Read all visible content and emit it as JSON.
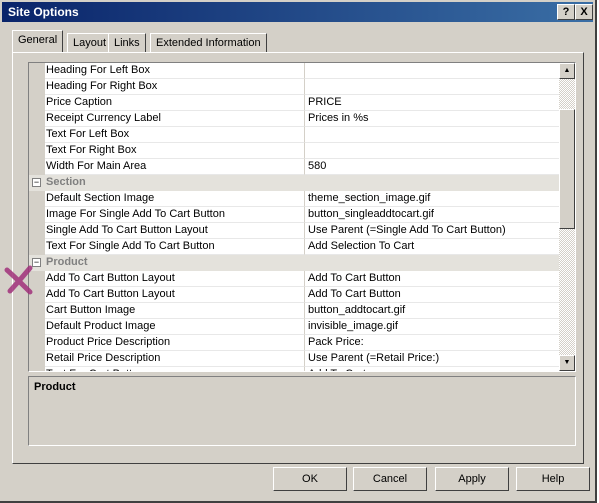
{
  "window": {
    "title": "Site Options",
    "help": "?",
    "close": "X"
  },
  "tabs": [
    "General",
    "Layout",
    "Links",
    "Extended Information"
  ],
  "left_fragment": "es",
  "rows": [
    {
      "type": "prop",
      "label": "Heading For Left Box",
      "value": ""
    },
    {
      "type": "prop",
      "label": "Heading For Right Box",
      "value": ""
    },
    {
      "type": "prop",
      "label": "Price Caption",
      "value": "PRICE"
    },
    {
      "type": "prop",
      "label": "Receipt Currency Label",
      "value": "Prices in %s"
    },
    {
      "type": "prop",
      "label": "Text For Left Box",
      "value": ""
    },
    {
      "type": "prop",
      "label": "Text For Right Box",
      "value": ""
    },
    {
      "type": "prop",
      "label": "Width For Main Area",
      "value": "580"
    },
    {
      "type": "cat",
      "label": "Section"
    },
    {
      "type": "prop",
      "label": "Default Section Image",
      "value": "theme_section_image.gif"
    },
    {
      "type": "prop",
      "label": "Image For Single Add To Cart Button",
      "value": "button_singleaddtocart.gif"
    },
    {
      "type": "prop",
      "label": "Single Add To Cart Button Layout",
      "value": "Use Parent (=Single Add To Cart Button)"
    },
    {
      "type": "prop",
      "label": "Text For Single Add To Cart Button",
      "value": "Add Selection To Cart"
    },
    {
      "type": "cat",
      "label": "Product"
    },
    {
      "type": "prop",
      "label": "Add To Cart Button Layout",
      "value": "Add To Cart Button"
    },
    {
      "type": "prop",
      "label": "Add To Cart Button Layout",
      "value": "Add To Cart Button"
    },
    {
      "type": "prop",
      "label": "Cart Button Image",
      "value": "button_addtocart.gif"
    },
    {
      "type": "prop",
      "label": "Default Product Image",
      "value": "invisible_image.gif"
    },
    {
      "type": "prop",
      "label": "Product Price Description",
      "value": "Pack Price:"
    },
    {
      "type": "prop",
      "label": "Retail Price Description",
      "value": "Use Parent (=Retail Price:)"
    },
    {
      "type": "prop",
      "label": "Text For Cart Button",
      "value": "Add To Cart"
    }
  ],
  "description": {
    "title": "Product"
  },
  "buttons": {
    "ok": "OK",
    "cancel": "Cancel",
    "apply": "Apply",
    "help": "Help"
  },
  "colors": {
    "titlebar": "#0a246a",
    "face": "#d4d0c8",
    "category": "#e4e2dc",
    "mark": "#a0307a"
  },
  "icons": {
    "collapse": "minus-box-icon",
    "scroll_up": "up-arrow-icon",
    "scroll_down": "down-arrow-icon"
  }
}
